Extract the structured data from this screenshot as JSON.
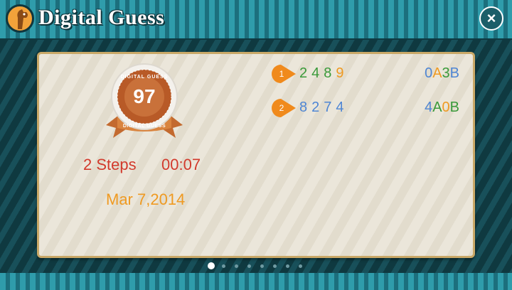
{
  "app": {
    "title": "Digital Guess",
    "close_label": "×"
  },
  "result_card": {
    "badge": {
      "score": "97",
      "ring_text": "DIGITAL GUESS",
      "ribbon_text": "DIGITAL GUESS"
    },
    "steps": "2 Steps",
    "elapsed": "00:07",
    "date": "Mar 7,2014"
  },
  "guesses": [
    {
      "number": "1",
      "digits": [
        "2",
        "4",
        "8",
        "9"
      ],
      "result": [
        "0",
        "A",
        "3",
        "B"
      ]
    },
    {
      "number": "2",
      "digits": [
        "8",
        "2",
        "7",
        "4"
      ],
      "result": [
        "4",
        "A",
        "0",
        "B"
      ]
    }
  ],
  "pagination": {
    "total": 8,
    "active_index": 0
  },
  "colors": {
    "accent_green": "#3a9a3a",
    "accent_orange": "#ef9a22",
    "accent_blue": "#4f86d4",
    "accent_red": "#d23a2c"
  }
}
